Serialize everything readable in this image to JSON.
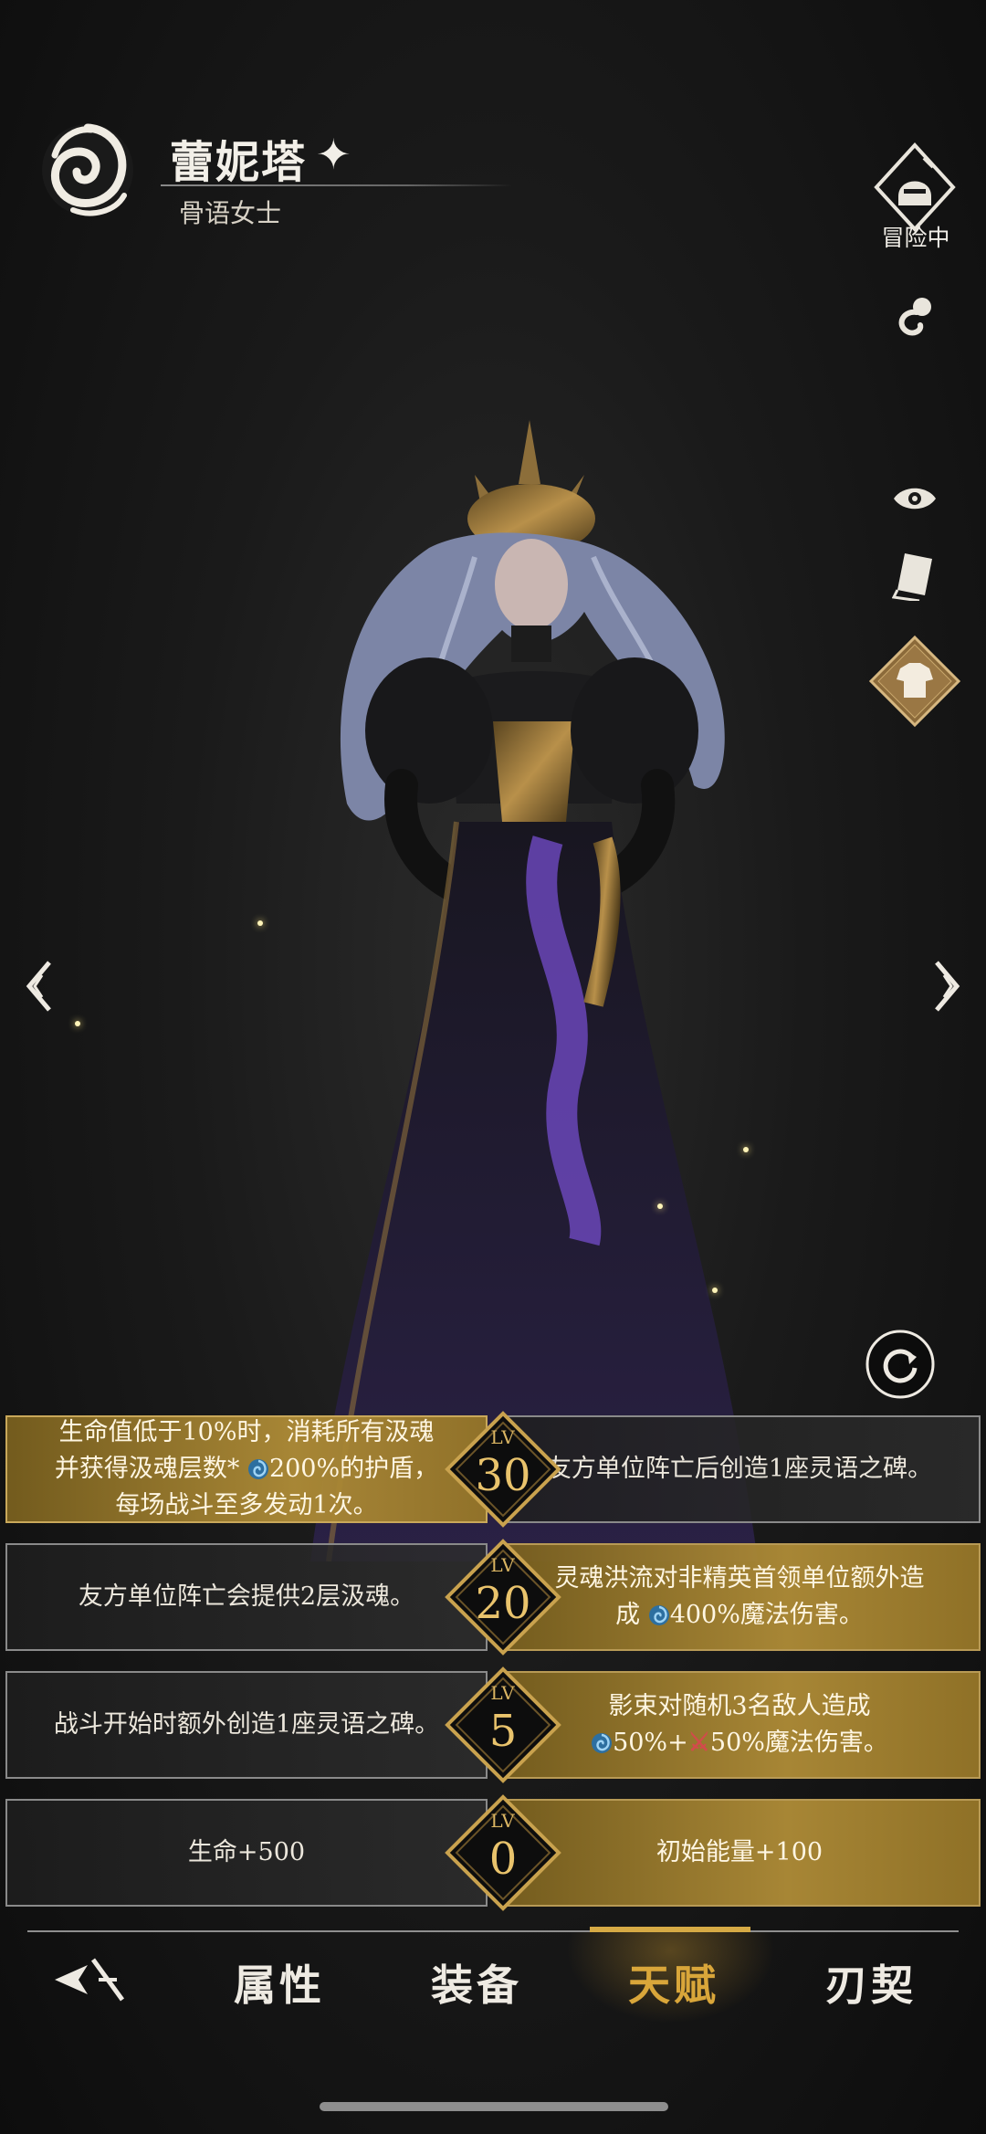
{
  "header": {
    "character_name": "蕾妮塔",
    "name_star": "✦",
    "character_title": "骨语女士",
    "faction_icon": "soul-swirl-icon"
  },
  "side_panel": {
    "adventure_status": "冒险中",
    "icons": [
      "adventure-knight-icon",
      "voice-icon",
      "eye-icon",
      "card-icon",
      "outfit-icon"
    ]
  },
  "talents": [
    {
      "level_label": "LV",
      "level": "30",
      "left": {
        "parts": [
          "生命值低于10%时，消耗所有汲魂",
          "并获得汲魂层数*",
          "200%的护盾，",
          "每场战斗至多发动1次。"
        ],
        "style": "gold"
      },
      "right": {
        "text": "友方单位阵亡后创造1座灵语之碑。",
        "style": "dark"
      }
    },
    {
      "level_label": "LV",
      "level": "20",
      "left": {
        "text": "友方单位阵亡会提供2层汲魂。",
        "style": "dark"
      },
      "right": {
        "parts": [
          "灵魂洪流对非精英首领单位额外造",
          "成",
          "400%魔法伤害。"
        ],
        "style": "gold"
      }
    },
    {
      "level_label": "LV",
      "level": "5",
      "left": {
        "text": "战斗开始时额外创造1座灵语之碑。",
        "style": "dark"
      },
      "right": {
        "parts": [
          "影束对随机3名敌人造成",
          "50%+",
          "50%魔法伤害。"
        ],
        "style": "gold"
      }
    },
    {
      "level_label": "LV",
      "level": "0",
      "left": {
        "text": "生命+500",
        "style": "dark"
      },
      "right": {
        "text": "初始能量+100",
        "style": "gold"
      }
    }
  ],
  "nav": {
    "tabs": [
      "属性",
      "装备",
      "天赋",
      "刃契"
    ],
    "active_tab": "天赋",
    "home_icon": "blade-home-icon"
  },
  "colors": {
    "accent_gold": "#d9a63a",
    "swirl_blue": "#4aa3d8",
    "sword_red": "#d24b4b"
  }
}
